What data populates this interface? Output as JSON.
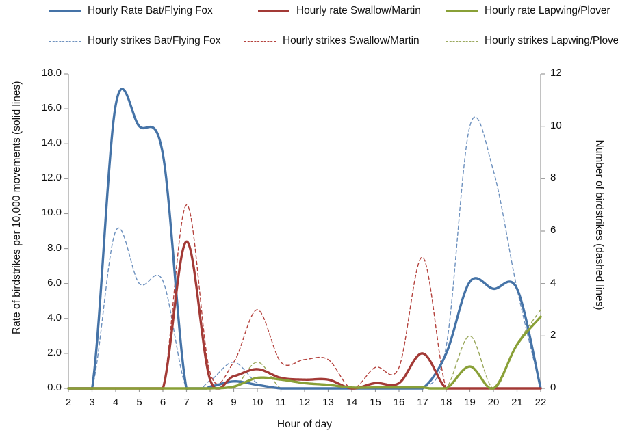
{
  "legend": {
    "rows": [
      [
        {
          "label": "Hourly Rate  Bat/Flying Fox",
          "style": "solid",
          "color": "#4573A7"
        },
        {
          "label": "Hourly rate Swallow/Martin",
          "style": "solid",
          "color": "#A33A36"
        },
        {
          "label": "Hourly rate Lapwing/Plover",
          "style": "solid",
          "color": "#89A037"
        }
      ],
      [
        {
          "label": "Hourly strikes Bat/Flying Fox",
          "style": "dashed",
          "color": "#6C90BE"
        },
        {
          "label": "Hourly strikes Swallow/Martin",
          "style": "dashed",
          "color": "#B4413C"
        },
        {
          "label": "Hourly strikes Lapwing/Plover",
          "style": "dashed",
          "color": "#9AA85C"
        }
      ]
    ]
  },
  "chart_data": {
    "type": "line",
    "title": "",
    "xlabel": "Hour of day",
    "ylabel": "Rate of birdstrikes per 10,000 movements (solid lines)",
    "y2label": "Number of birdstrikes (dashed lines)",
    "x": [
      2,
      3,
      4,
      5,
      6,
      7,
      8,
      9,
      10,
      11,
      12,
      13,
      14,
      15,
      16,
      17,
      18,
      19,
      20,
      21,
      22
    ],
    "xticklabels": [
      "2",
      "3",
      "4",
      "5",
      "6",
      "7",
      "8",
      "9",
      "10",
      "11",
      "12",
      "13",
      "14",
      "15",
      "16",
      "17",
      "18",
      "19",
      "20",
      "21",
      "22"
    ],
    "xlim": [
      2,
      22
    ],
    "ylim": [
      0,
      18
    ],
    "yticks": [
      0,
      2,
      4,
      6,
      8,
      10,
      12,
      14,
      16,
      18
    ],
    "yticklabels": [
      "0.0",
      "2.0",
      "4.0",
      "6.0",
      "8.0",
      "10.0",
      "12.0",
      "14.0",
      "16.0",
      "18.0"
    ],
    "y2lim": [
      0,
      12
    ],
    "y2ticks": [
      0,
      2,
      4,
      6,
      8,
      10,
      12
    ],
    "y2ticklabels": [
      "0",
      "2",
      "4",
      "6",
      "8",
      "10",
      "12"
    ],
    "grid": false,
    "legend_position": "top",
    "series": [
      {
        "name": "Hourly Rate  Bat/Flying Fox",
        "axis": "left",
        "style": "solid",
        "color": "#4573A7",
        "width": 3.4,
        "values": [
          0,
          0,
          16.2,
          15.0,
          13.4,
          0,
          0.1,
          0.4,
          0.2,
          0,
          0,
          0,
          0,
          0,
          0,
          0,
          2.0,
          6.1,
          5.7,
          5.7,
          0
        ]
      },
      {
        "name": "Hourly rate Swallow/Martin",
        "axis": "left",
        "style": "solid",
        "color": "#A33A36",
        "width": 3.4,
        "values": [
          0,
          0,
          0,
          0,
          0,
          8.4,
          0.5,
          0.7,
          1.1,
          0.6,
          0.5,
          0.5,
          0.0,
          0.3,
          0.3,
          2.0,
          0,
          0,
          0,
          0,
          0
        ]
      },
      {
        "name": "Hourly rate Lapwing/Plover",
        "axis": "left",
        "style": "solid",
        "color": "#89A037",
        "width": 3.4,
        "values": [
          0,
          0,
          0,
          0,
          0,
          0,
          0,
          0.1,
          0.6,
          0.5,
          0.3,
          0.2,
          0.05,
          0.05,
          0.05,
          0.05,
          0,
          1.25,
          0,
          2.5,
          4.1
        ]
      },
      {
        "name": "Hourly strikes Bat/Flying Fox",
        "axis": "right",
        "style": "dashed",
        "color": "#6C90BE",
        "width": 1.4,
        "values": [
          0,
          0,
          6.0,
          4.0,
          4.1,
          0,
          0.3,
          1.0,
          0.2,
          0,
          0,
          0,
          0,
          0,
          0,
          0,
          1.6,
          10.0,
          8.3,
          3.8,
          0
        ]
      },
      {
        "name": "Hourly strikes Swallow/Martin",
        "axis": "right",
        "style": "dashed",
        "color": "#B4413C",
        "width": 1.4,
        "values": [
          0,
          0,
          0,
          0,
          0,
          7.0,
          0.6,
          1.0,
          3.0,
          1.0,
          1.1,
          1.1,
          0.0,
          0.8,
          0.8,
          5.0,
          0,
          0,
          0,
          0,
          0
        ]
      },
      {
        "name": "Hourly strikes Lapwing/Plover",
        "axis": "right",
        "style": "dashed",
        "color": "#9AA85C",
        "width": 1.4,
        "values": [
          0,
          0,
          0,
          0,
          0,
          0,
          0,
          0,
          1.0,
          0,
          0,
          0,
          0,
          0,
          0,
          0,
          0,
          2.0,
          0,
          1.7,
          3.0
        ]
      }
    ]
  }
}
